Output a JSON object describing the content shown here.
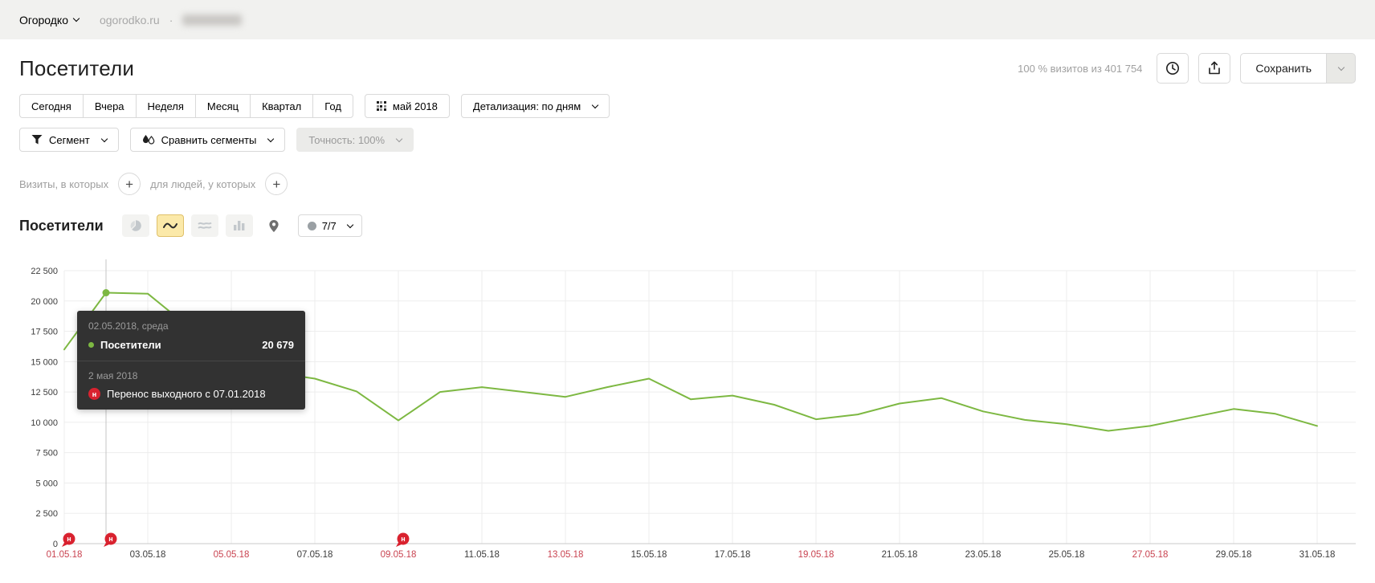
{
  "colors": {
    "green": "#7db842",
    "badge_red": "#d9222f",
    "label_red": "#c94350",
    "grid": "#ededed",
    "axis": "#c9c9c9",
    "crosshair": "#c4c4c4"
  },
  "topbar": {
    "project": "Огородко",
    "site": "ogorodko.ru",
    "separator": "·"
  },
  "header": {
    "title": "Посетители",
    "visits_summary": "100 % визитов из 401 754",
    "save_label": "Сохранить"
  },
  "period_tabs": [
    "Сегодня",
    "Вчера",
    "Неделя",
    "Месяц",
    "Квартал",
    "Год"
  ],
  "date_picker": {
    "label": "май 2018"
  },
  "detalization": {
    "label": "Детализация: по дням"
  },
  "segment_row": {
    "segment": "Сегмент",
    "compare": "Сравнить сегменты",
    "accuracy": "Точность: 100%"
  },
  "filters": {
    "visits": "Визиты, в которых",
    "people": "для людей, у которых",
    "plus": "+"
  },
  "chart_header": {
    "title": "Посетители",
    "annotations_count": "7/7"
  },
  "tooltip": {
    "date_line": "02.05.2018, среда",
    "metric": "Посетители",
    "value": "20 679",
    "annotation_date": "2 мая 2018",
    "annotation_badge": "н",
    "annotation_text": "Перенос выходного с 07.01.2018"
  },
  "chart_data": {
    "type": "line",
    "title": "Посетители",
    "xlabel": "",
    "ylabel": "",
    "ylim": [
      0,
      22500
    ],
    "grid": true,
    "x": [
      1,
      2,
      3,
      4,
      5,
      6,
      7,
      8,
      9,
      10,
      11,
      12,
      13,
      14,
      15,
      16,
      17,
      18,
      19,
      20,
      21,
      22,
      23,
      24,
      25,
      26,
      27,
      28,
      29,
      30,
      31
    ],
    "series": [
      {
        "name": "Посетители",
        "values": [
          16000,
          20679,
          20600,
          17800,
          15400,
          14100,
          13600,
          12550,
          10150,
          12500,
          12900,
          12500,
          12100,
          12900,
          13600,
          11900,
          12200,
          11450,
          10250,
          10650,
          11550,
          12000,
          10900,
          10200,
          9850,
          9300,
          9700,
          10400,
          11100,
          10700,
          9700
        ]
      }
    ],
    "y_ticks": [
      {
        "value": 0,
        "label": "0"
      },
      {
        "value": 2500,
        "label": "2 500"
      },
      {
        "value": 5000,
        "label": "5 000"
      },
      {
        "value": 7500,
        "label": "7 500"
      },
      {
        "value": 10000,
        "label": "10 000"
      },
      {
        "value": 12500,
        "label": "12 500"
      },
      {
        "value": 15000,
        "label": "15 000"
      },
      {
        "value": 17500,
        "label": "17 500"
      },
      {
        "value": 20000,
        "label": "20 000"
      },
      {
        "value": 22500,
        "label": "22 500"
      }
    ],
    "x_ticks": [
      {
        "day": 1,
        "label": "01.05.18",
        "red": true
      },
      {
        "day": 3,
        "label": "03.05.18",
        "red": false
      },
      {
        "day": 5,
        "label": "05.05.18",
        "red": true
      },
      {
        "day": 7,
        "label": "07.05.18",
        "red": false
      },
      {
        "day": 9,
        "label": "09.05.18",
        "red": true
      },
      {
        "day": 11,
        "label": "11.05.18",
        "red": false
      },
      {
        "day": 13,
        "label": "13.05.18",
        "red": true
      },
      {
        "day": 15,
        "label": "15.05.18",
        "red": false
      },
      {
        "day": 17,
        "label": "17.05.18",
        "red": false
      },
      {
        "day": 19,
        "label": "19.05.18",
        "red": true
      },
      {
        "day": 21,
        "label": "21.05.18",
        "red": false
      },
      {
        "day": 23,
        "label": "23.05.18",
        "red": false
      },
      {
        "day": 25,
        "label": "25.05.18",
        "red": false
      },
      {
        "day": 27,
        "label": "27.05.18",
        "red": true
      },
      {
        "day": 29,
        "label": "29.05.18",
        "red": false
      },
      {
        "day": 31,
        "label": "31.05.18",
        "red": false
      }
    ],
    "highlight": {
      "day": 2,
      "value": 20679,
      "label": "20 679"
    },
    "holiday_markers": [
      {
        "day": 1,
        "label": "н"
      },
      {
        "day": 2,
        "label": "н"
      },
      {
        "day": 9,
        "label": "н"
      }
    ]
  }
}
